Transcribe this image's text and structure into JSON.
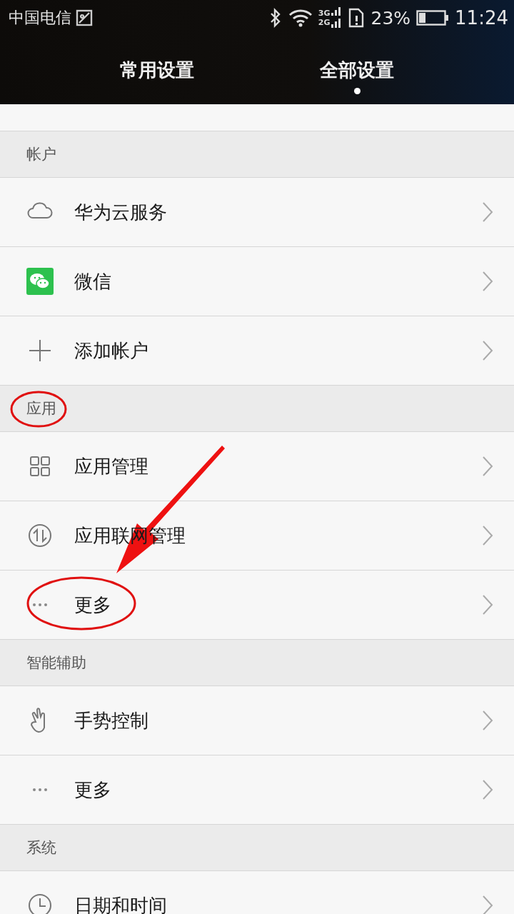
{
  "status_bar": {
    "carrier": "中国电信",
    "network_top": "3G",
    "network_bottom": "2G",
    "battery_percent": "23%",
    "time": "11:24"
  },
  "tabs": [
    {
      "label": "常用设置",
      "selected": false
    },
    {
      "label": "全部设置",
      "selected": true
    }
  ],
  "sections": [
    {
      "title": "帐户",
      "items": [
        {
          "label": "华为云服务",
          "kind": "cloud"
        },
        {
          "label": "微信",
          "kind": "wechat"
        },
        {
          "label": "添加帐户",
          "kind": "plus"
        }
      ]
    },
    {
      "title": "应用",
      "items": [
        {
          "label": "应用管理",
          "kind": "grid"
        },
        {
          "label": "应用联网管理",
          "kind": "updown"
        },
        {
          "label": "更多",
          "kind": "dots"
        }
      ]
    },
    {
      "title": "智能辅助",
      "items": [
        {
          "label": "手势控制",
          "kind": "hand"
        },
        {
          "label": "更多",
          "kind": "dots"
        }
      ]
    },
    {
      "title": "系统",
      "items": [
        {
          "label": "日期和时间",
          "kind": "clock"
        }
      ]
    }
  ]
}
